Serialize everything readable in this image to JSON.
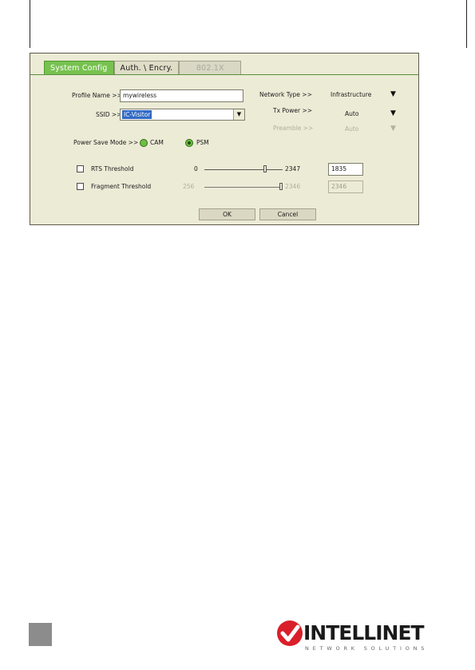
{
  "tabs": {
    "system_config": "System Config",
    "auth_encry": "Auth. \\ Encry.",
    "x8021": "802.1X"
  },
  "profile_name": {
    "label": "Profile Name >>",
    "value": "mywireless"
  },
  "ssid": {
    "label": "SSID >>",
    "value": "IC-Visitor",
    "dropdown_icon": "▼"
  },
  "network_type": {
    "label": "Network Type >>",
    "value": "Infrastructure",
    "arrow_icon": "▼"
  },
  "tx_power": {
    "label": "Tx Power >>",
    "value": "Auto",
    "arrow_icon": "▼"
  },
  "preamble": {
    "label": "Preamble >>",
    "value": "Auto",
    "arrow_icon": "▼"
  },
  "power_save": {
    "label": "Power Save Mode >>",
    "cam_label": "CAM",
    "psm_label": "PSM",
    "selected": "PSM"
  },
  "rts": {
    "label": "RTS Threshold",
    "min": "0",
    "max": "2347",
    "value": "1835",
    "checked": false,
    "level": 0.78
  },
  "fragment": {
    "label": "Fragment Threshold",
    "min": "256",
    "max": "2346",
    "value": "2346",
    "checked": false,
    "level": 1.0
  },
  "buttons": {
    "ok": "OK",
    "cancel": "Cancel"
  },
  "brand": {
    "name": "INTELLINET",
    "tagline": "NETWORK SOLUTIONS",
    "accent": "#d9202a"
  },
  "colors": {
    "active_tab": "#77c24f",
    "dialog_bg": "#ecebd6",
    "selection": "#316ac5"
  }
}
